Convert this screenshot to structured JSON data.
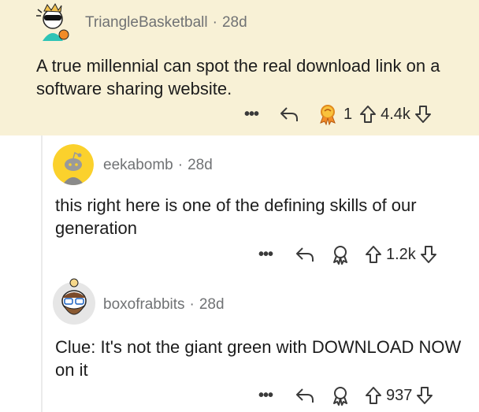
{
  "comments": [
    {
      "username": "TriangleBasketball",
      "separator": "·",
      "age": "28d",
      "text": "A true millennial can spot the real download link on a software sharing website.",
      "more": "•••",
      "award_count": "1",
      "votes": "4.4k",
      "highlight_color": "#f8f1d6"
    },
    {
      "username": "eekabomb",
      "separator": "·",
      "age": "28d",
      "text": "this right here is one of the defining skills of our generation",
      "more": "•••",
      "votes": "1.2k"
    },
    {
      "username": "boxofrabbits",
      "separator": "·",
      "age": "28d",
      "text": "Clue: It's not the giant green with DOWNLOAD NOW on it",
      "more": "•••",
      "votes": "937"
    }
  ],
  "icons": {
    "reply": "reply-arrow-icon",
    "award": "award-icon",
    "upvote": "upvote-arrow-icon",
    "downvote": "downvote-arrow-icon"
  }
}
